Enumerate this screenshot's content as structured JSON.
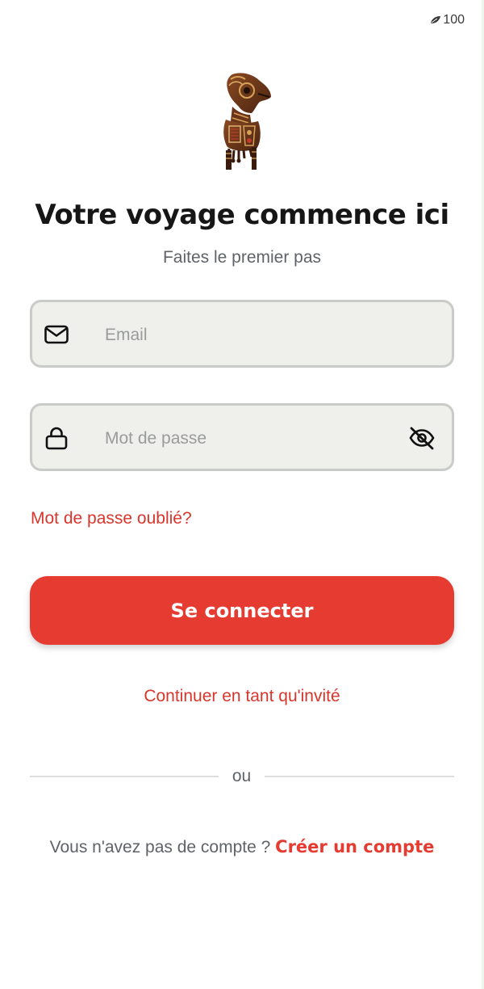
{
  "status_bar": {
    "battery_level": "100",
    "battery_icon": "battery-saver-icon"
  },
  "logo": {
    "icon": "african-bird-sculpture-logo"
  },
  "header": {
    "title": "Votre voyage commence ici",
    "subtitle": "Faites le premier pas"
  },
  "form": {
    "email": {
      "placeholder": "Email",
      "value": "",
      "icon": "mail-icon"
    },
    "password": {
      "placeholder": "Mot de passe",
      "value": "",
      "icon": "lock-icon",
      "toggle_icon": "eye-off-icon"
    },
    "forgot_label": "Mot de passe oublié?",
    "submit_label": "Se connecter"
  },
  "guest_label": "Continuer en tant qu'invité",
  "divider_label": "ou",
  "signup": {
    "prompt": "Vous n'avez pas de compte ?",
    "link_label": "Créer un compte"
  },
  "colors": {
    "accent": "#e63b30",
    "link": "#d8362c",
    "field_bg": "#eff0ec",
    "field_border": "#c9cbc9",
    "text_primary": "#161616",
    "text_secondary": "#5f6368"
  }
}
